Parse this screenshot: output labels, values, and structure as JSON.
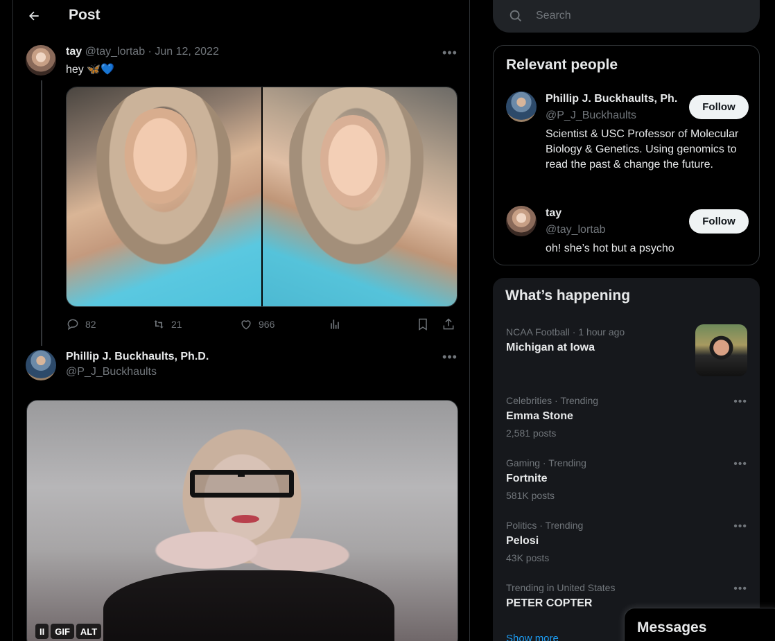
{
  "header": {
    "title": "Post"
  },
  "tweet1": {
    "name": "tay",
    "handle": "@tay_lortab",
    "date": "Jun 12, 2022",
    "text": "hey 🦋💙",
    "replies": "82",
    "retweets": "21",
    "likes": "966"
  },
  "tweet2": {
    "name": "Phillip J. Buckhaults, Ph.D.",
    "handle": "@P_J_Buckhaults",
    "gif_controls": [
      "II",
      "GIF",
      "ALT"
    ]
  },
  "search": {
    "placeholder": "Search"
  },
  "relevant": {
    "title": "Relevant people",
    "people": [
      {
        "name": "Phillip J. Buckhaults, Ph.",
        "handle": "@P_J_Buckhaults",
        "bio": "Scientist & USC Professor of Molecular Biology & Genetics. Using genomics to read the past & change the future.",
        "button": "Follow"
      },
      {
        "name": "tay",
        "handle": "@tay_lortab",
        "bio": "oh! she’s hot but a psycho",
        "button": "Follow"
      }
    ]
  },
  "happening": {
    "title": "What’s happening",
    "trends": [
      {
        "meta": "NCAA Football · 1 hour ago",
        "title": "Michigan at Iowa",
        "count": ""
      },
      {
        "meta": "Celebrities · Trending",
        "title": "Emma Stone",
        "count": "2,581 posts"
      },
      {
        "meta": "Gaming · Trending",
        "title": "Fortnite",
        "count": "581K posts"
      },
      {
        "meta": "Politics · Trending",
        "title": "Pelosi",
        "count": "43K posts"
      },
      {
        "meta": "Trending in United States",
        "title": "PETER COPTER",
        "count": ""
      }
    ],
    "show_more": "Show more"
  },
  "messages": {
    "title": "Messages"
  },
  "colors": {
    "accent": "#1d9bf0",
    "muted": "#71767b",
    "text": "#e7e9ea",
    "border": "#2f3336"
  }
}
